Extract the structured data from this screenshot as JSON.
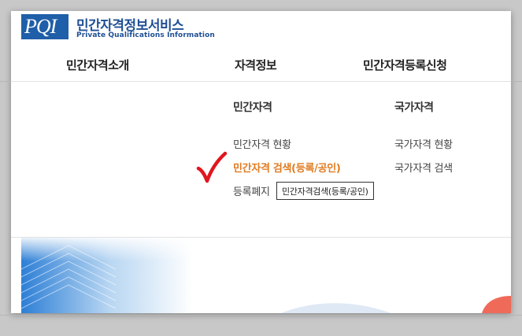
{
  "header": {
    "logo_mark": "PQI",
    "title": "민간자격정보서비스",
    "subtitle": "Private Qualifications Information"
  },
  "nav": {
    "items": [
      {
        "label": "민간자격소개"
      },
      {
        "label": "자격정보"
      },
      {
        "label": "민간자격등록신청"
      }
    ]
  },
  "submenu": {
    "columns": [
      {
        "heading": "민간자격",
        "links": [
          "민간자격 현황",
          "민간자격 검색(등록/공인)",
          "등록폐지"
        ]
      },
      {
        "heading": "국가자격",
        "links": [
          "국가자격 현황",
          "국가자격 검색"
        ]
      }
    ],
    "highlighted_link": "민간자격 검색(등록/공인)",
    "tooltip": "민간자격검색(등록/공인)"
  },
  "colors": {
    "brand_blue": "#1f5ea8",
    "highlight_orange": "#e07b20",
    "check_red": "#e0161f"
  },
  "icons": {
    "checkmark": "red-checkmark-icon"
  }
}
